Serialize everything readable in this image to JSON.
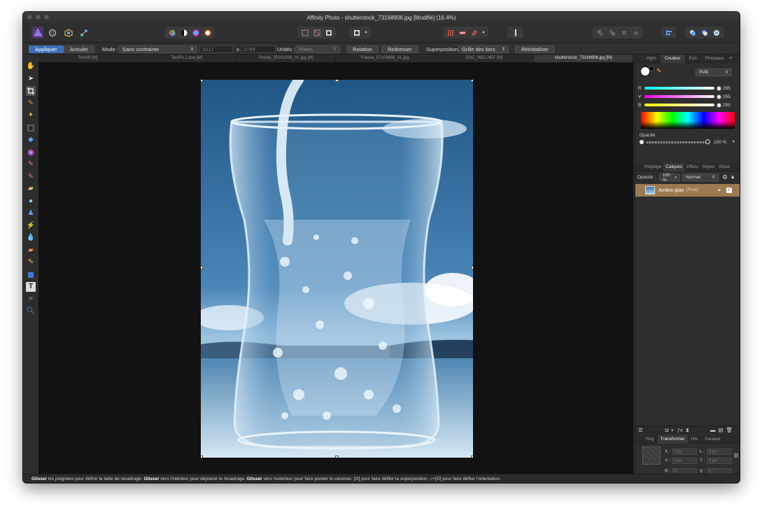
{
  "window": {
    "title": "Affinity Photo - shutterstock_73168906.jpg [Modifié] (16.4%)"
  },
  "context": {
    "apply": "Appliquer",
    "cancel": "Annuler",
    "mode_label": "Mode :",
    "mode_value": "Sans contrainte",
    "width_value": "2017",
    "x_sep": "x",
    "height_value": "2789",
    "units_label": "Unités :",
    "units_value": "Pixels",
    "rotation": "Rotation",
    "straighten": "Redresser",
    "overlay_label": "Superposition:",
    "overlay_value": "Grille des tiers",
    "reset": "Réinitialiser"
  },
  "doc_tabs": [
    "TestAff [M]",
    "TestPs 2.psd [M]",
    "Fotolia_59162209_XL.jpg [M]",
    "Fotolia_57103666_XL.jpg",
    "DSC_0652.NEF [M]",
    "shutterstock_73168906.jpg [M]"
  ],
  "panel_top": {
    "tabs": [
      "Hgm",
      "Couleur",
      "Éch",
      "Pinceaux"
    ],
    "color_model": "RVB",
    "r_label": "R",
    "r_value": "255",
    "g_label": "V",
    "g_value": "255",
    "b_label": "B",
    "b_value": "255",
    "opacity_label": "Opacité",
    "opacity_value": "100 %"
  },
  "panel_layers": {
    "tabs": [
      "Réglage",
      "Calques",
      "Effets",
      "Styles",
      "Stock"
    ],
    "opacity_label": "Opacité :",
    "opacity_value": "100 %",
    "blend_mode": "Normal",
    "layer_name": "Arrière-plan",
    "layer_type": "(Pixel)"
  },
  "panel_transform": {
    "tabs": [
      "Nvg",
      "Transformer",
      "His",
      "Canaux"
    ],
    "x_label": "X :",
    "x_value": "0 px",
    "w_label": "L :",
    "w_value": "0 px",
    "y_label": "Y :",
    "y_value": "0 px",
    "h_label": "T :",
    "h_value": "0 px",
    "r_label": "R :",
    "r_value": "0 °",
    "s_label": "S :",
    "s_value": "0 °"
  },
  "status": {
    "part1": "Glisser",
    "part2": " les poignées pour définir la taille de recadrage. ",
    "part3": "Glisser",
    "part4": " vers l'intérieur pour déplacer le recadrage. ",
    "part5": "Glisser",
    "part6": " vers l'extérieur pour faire pivoter le canevas. [O] pour faire défiler la superposition, ⌂+[O] pour faire défiler l'orientation."
  },
  "colors": {
    "accent": "#3e6fb5",
    "selected_layer": "#9c7a4e",
    "canvas_bg": "#121212"
  },
  "icons": {
    "tools": [
      "hand-icon",
      "pointer-icon",
      "crop-icon",
      "brush-icon",
      "flood-select-icon",
      "marquee-icon",
      "fill-icon",
      "gradient-icon",
      "paint-brush-icon",
      "color-replace-icon",
      "eraser-icon",
      "blur-icon",
      "clone-icon",
      "inpainting-icon",
      "drop-icon",
      "dodge-icon",
      "burn-icon",
      "shape-icon",
      "text-icon",
      "pen-icon",
      "zoom-icon"
    ]
  }
}
